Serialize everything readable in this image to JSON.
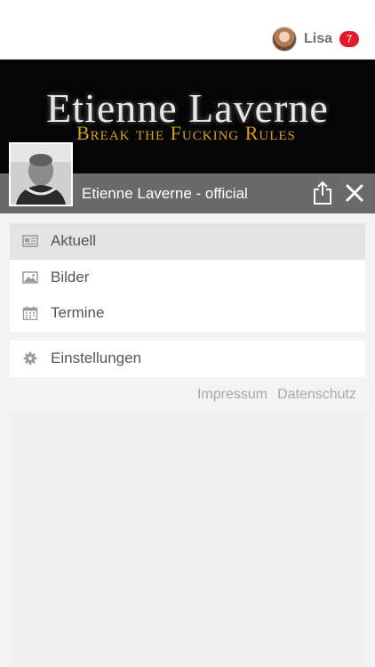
{
  "header": {
    "username": "Lisa",
    "notification_count": "7"
  },
  "banner": {
    "title": "Etienne Laverne",
    "subtitle": "Break the Fucking Rules"
  },
  "profile": {
    "page_name": "Etienne Laverne - official"
  },
  "menu": {
    "items": [
      {
        "label": "Aktuell",
        "icon": "newspaper-icon",
        "active": true
      },
      {
        "label": "Bilder",
        "icon": "image-icon",
        "active": false
      },
      {
        "label": "Termine",
        "icon": "calendar-icon",
        "active": false
      }
    ],
    "settings": {
      "label": "Einstellungen",
      "icon": "gear-icon"
    }
  },
  "footer": {
    "impressum": "Impressum",
    "datenschutz": "Datenschutz"
  },
  "colors": {
    "badge": "#e4182b",
    "titlebar": "#707070",
    "active_item": "#e3e3e3"
  }
}
